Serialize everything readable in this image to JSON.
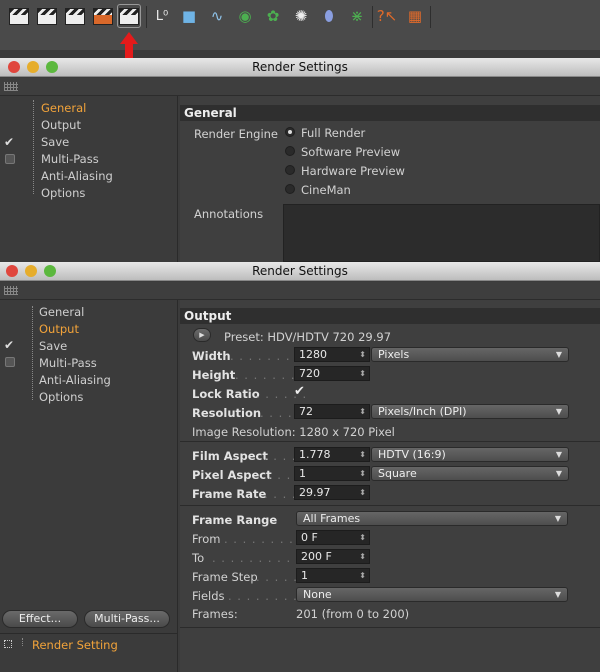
{
  "toolbar": {
    "items": [
      "render-view-icon",
      "render-region-icon",
      "render-picture-viewer-icon",
      "render-active-picture-icon",
      "render-settings-icon",
      "null-object-icon",
      "cube-icon",
      "spline-icon",
      "nurbs-icon",
      "array-icon",
      "particle-icon",
      "deformer-icon",
      "scene-icon",
      "help-icon",
      "layout-icon"
    ]
  },
  "window1": {
    "title": "Render Settings",
    "tree": {
      "general": "General",
      "output": "Output",
      "save": "Save",
      "multipass": "Multi-Pass",
      "antialiasing": "Anti-Aliasing",
      "options": "Options"
    },
    "section": "General",
    "render_engine_label": "Render Engine",
    "engines": [
      "Full Render",
      "Software Preview",
      "Hardware Preview",
      "CineMan"
    ],
    "annotations_label": "Annotations"
  },
  "window2": {
    "title": "Render Settings",
    "tree": {
      "general": "General",
      "output": "Output",
      "save": "Save",
      "multipass": "Multi-Pass",
      "antialiasing": "Anti-Aliasing",
      "options": "Options"
    },
    "section": "Output",
    "preset": "Preset: HDV/HDTV 720 29.97",
    "width_label": "Width",
    "width_value": "1280",
    "width_unit": "Pixels",
    "height_label": "Height",
    "height_value": "720",
    "lock_ratio_label": "Lock Ratio",
    "lock_ratio_check": "✔",
    "resolution_label": "Resolution",
    "resolution_value": "72",
    "resolution_unit": "Pixels/Inch (DPI)",
    "image_resolution": "Image Resolution: 1280 x 720 Pixel",
    "film_aspect_label": "Film Aspect",
    "film_aspect_value": "1.778",
    "film_aspect_preset": "HDTV (16:9)",
    "pixel_aspect_label": "Pixel Aspect",
    "pixel_aspect_value": "1",
    "pixel_aspect_preset": "Square",
    "frame_rate_label": "Frame Rate",
    "frame_rate_value": "29.97",
    "frame_range_label": "Frame Range",
    "frame_range_value": "All Frames",
    "from_label": "From",
    "from_value": "0 F",
    "to_label": "To",
    "to_value": "200 F",
    "frame_step_label": "Frame Step",
    "frame_step_value": "1",
    "fields_label": "Fields",
    "fields_value": "None",
    "frames_label": "Frames:",
    "frames_value": "201 (from 0 to 200)",
    "effect_button": "Effect...",
    "multipass_button": "Multi-Pass...",
    "render_setting_item": "Render Setting"
  }
}
